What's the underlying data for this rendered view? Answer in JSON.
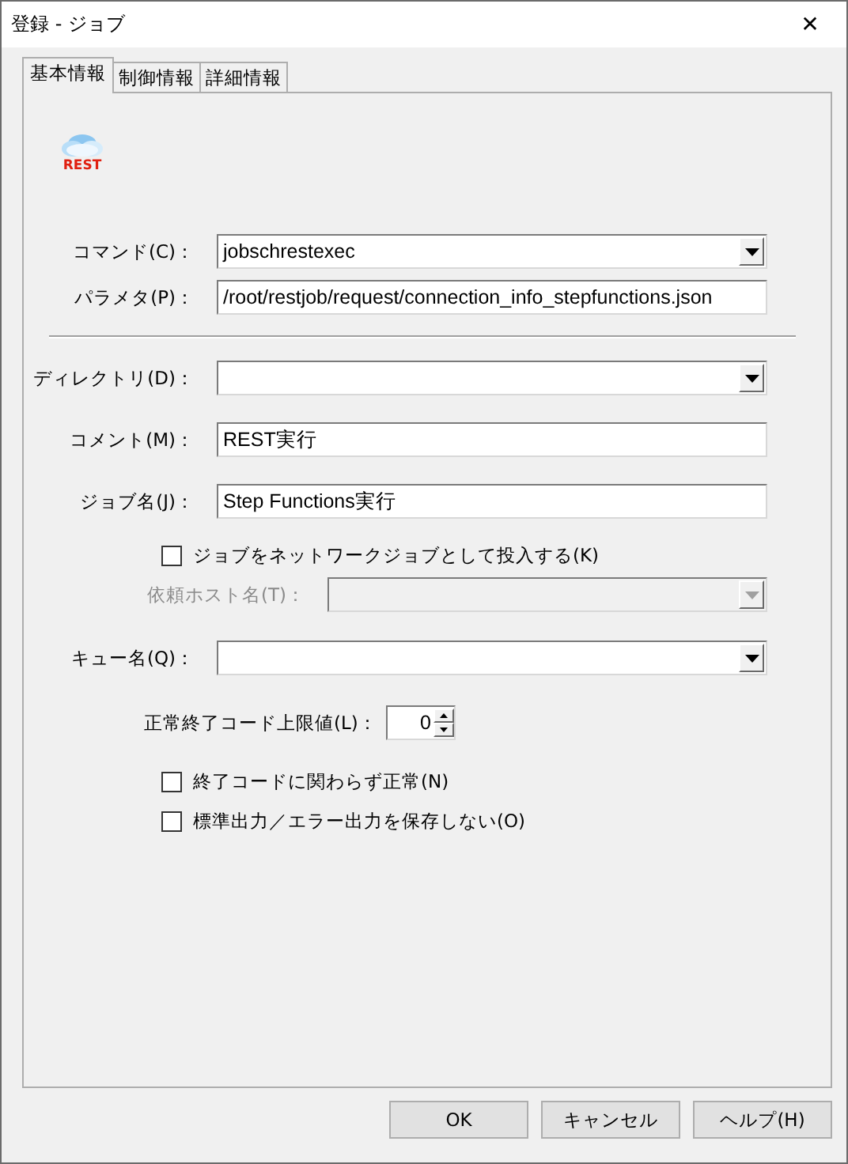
{
  "window": {
    "title": "登録 - ジョブ",
    "close": "✕"
  },
  "logo": {
    "text": "REST"
  },
  "tabs": [
    {
      "label": "基本情報",
      "selected": true
    },
    {
      "label": "制御情報",
      "selected": false
    },
    {
      "label": "詳細情報",
      "selected": false
    }
  ],
  "fields": [
    {
      "kind": "combo",
      "label": "コマンド(C)：",
      "value": "jobschrestexec"
    },
    {
      "kind": "text",
      "label": "パラメタ(P)：",
      "value": "/root/restjob/request/connection_info_stepfunctions.json"
    },
    {
      "kind": "separator"
    },
    {
      "kind": "combo",
      "label": "ディレクトリ(D)："
    },
    {
      "kind": "text",
      "label": "コメント(M)：",
      "value": "REST実行"
    },
    {
      "kind": "text",
      "label": "ジョブ名(J)：",
      "value": "Step Functions実行"
    },
    {
      "kind": "check",
      "label": "ジョブをネットワークジョブとして投入する(K)",
      "checked": false
    },
    {
      "kind": "combo",
      "label": "依頼ホスト名(T)：",
      "disabled": true,
      "indent": true
    },
    {
      "kind": "combo",
      "label": "キュー名(Q)："
    },
    {
      "kind": "spin",
      "label": "正常終了コード上限値(L)：",
      "value": "0"
    },
    {
      "kind": "check",
      "label": "終了コードに関わらず正常(N)",
      "checked": false
    },
    {
      "kind": "check",
      "label": "標準出力／エラー出力を保存しない(O)",
      "checked": false
    }
  ],
  "buttons": [
    "OK",
    "キャンセル",
    "ヘルプ(H)"
  ]
}
